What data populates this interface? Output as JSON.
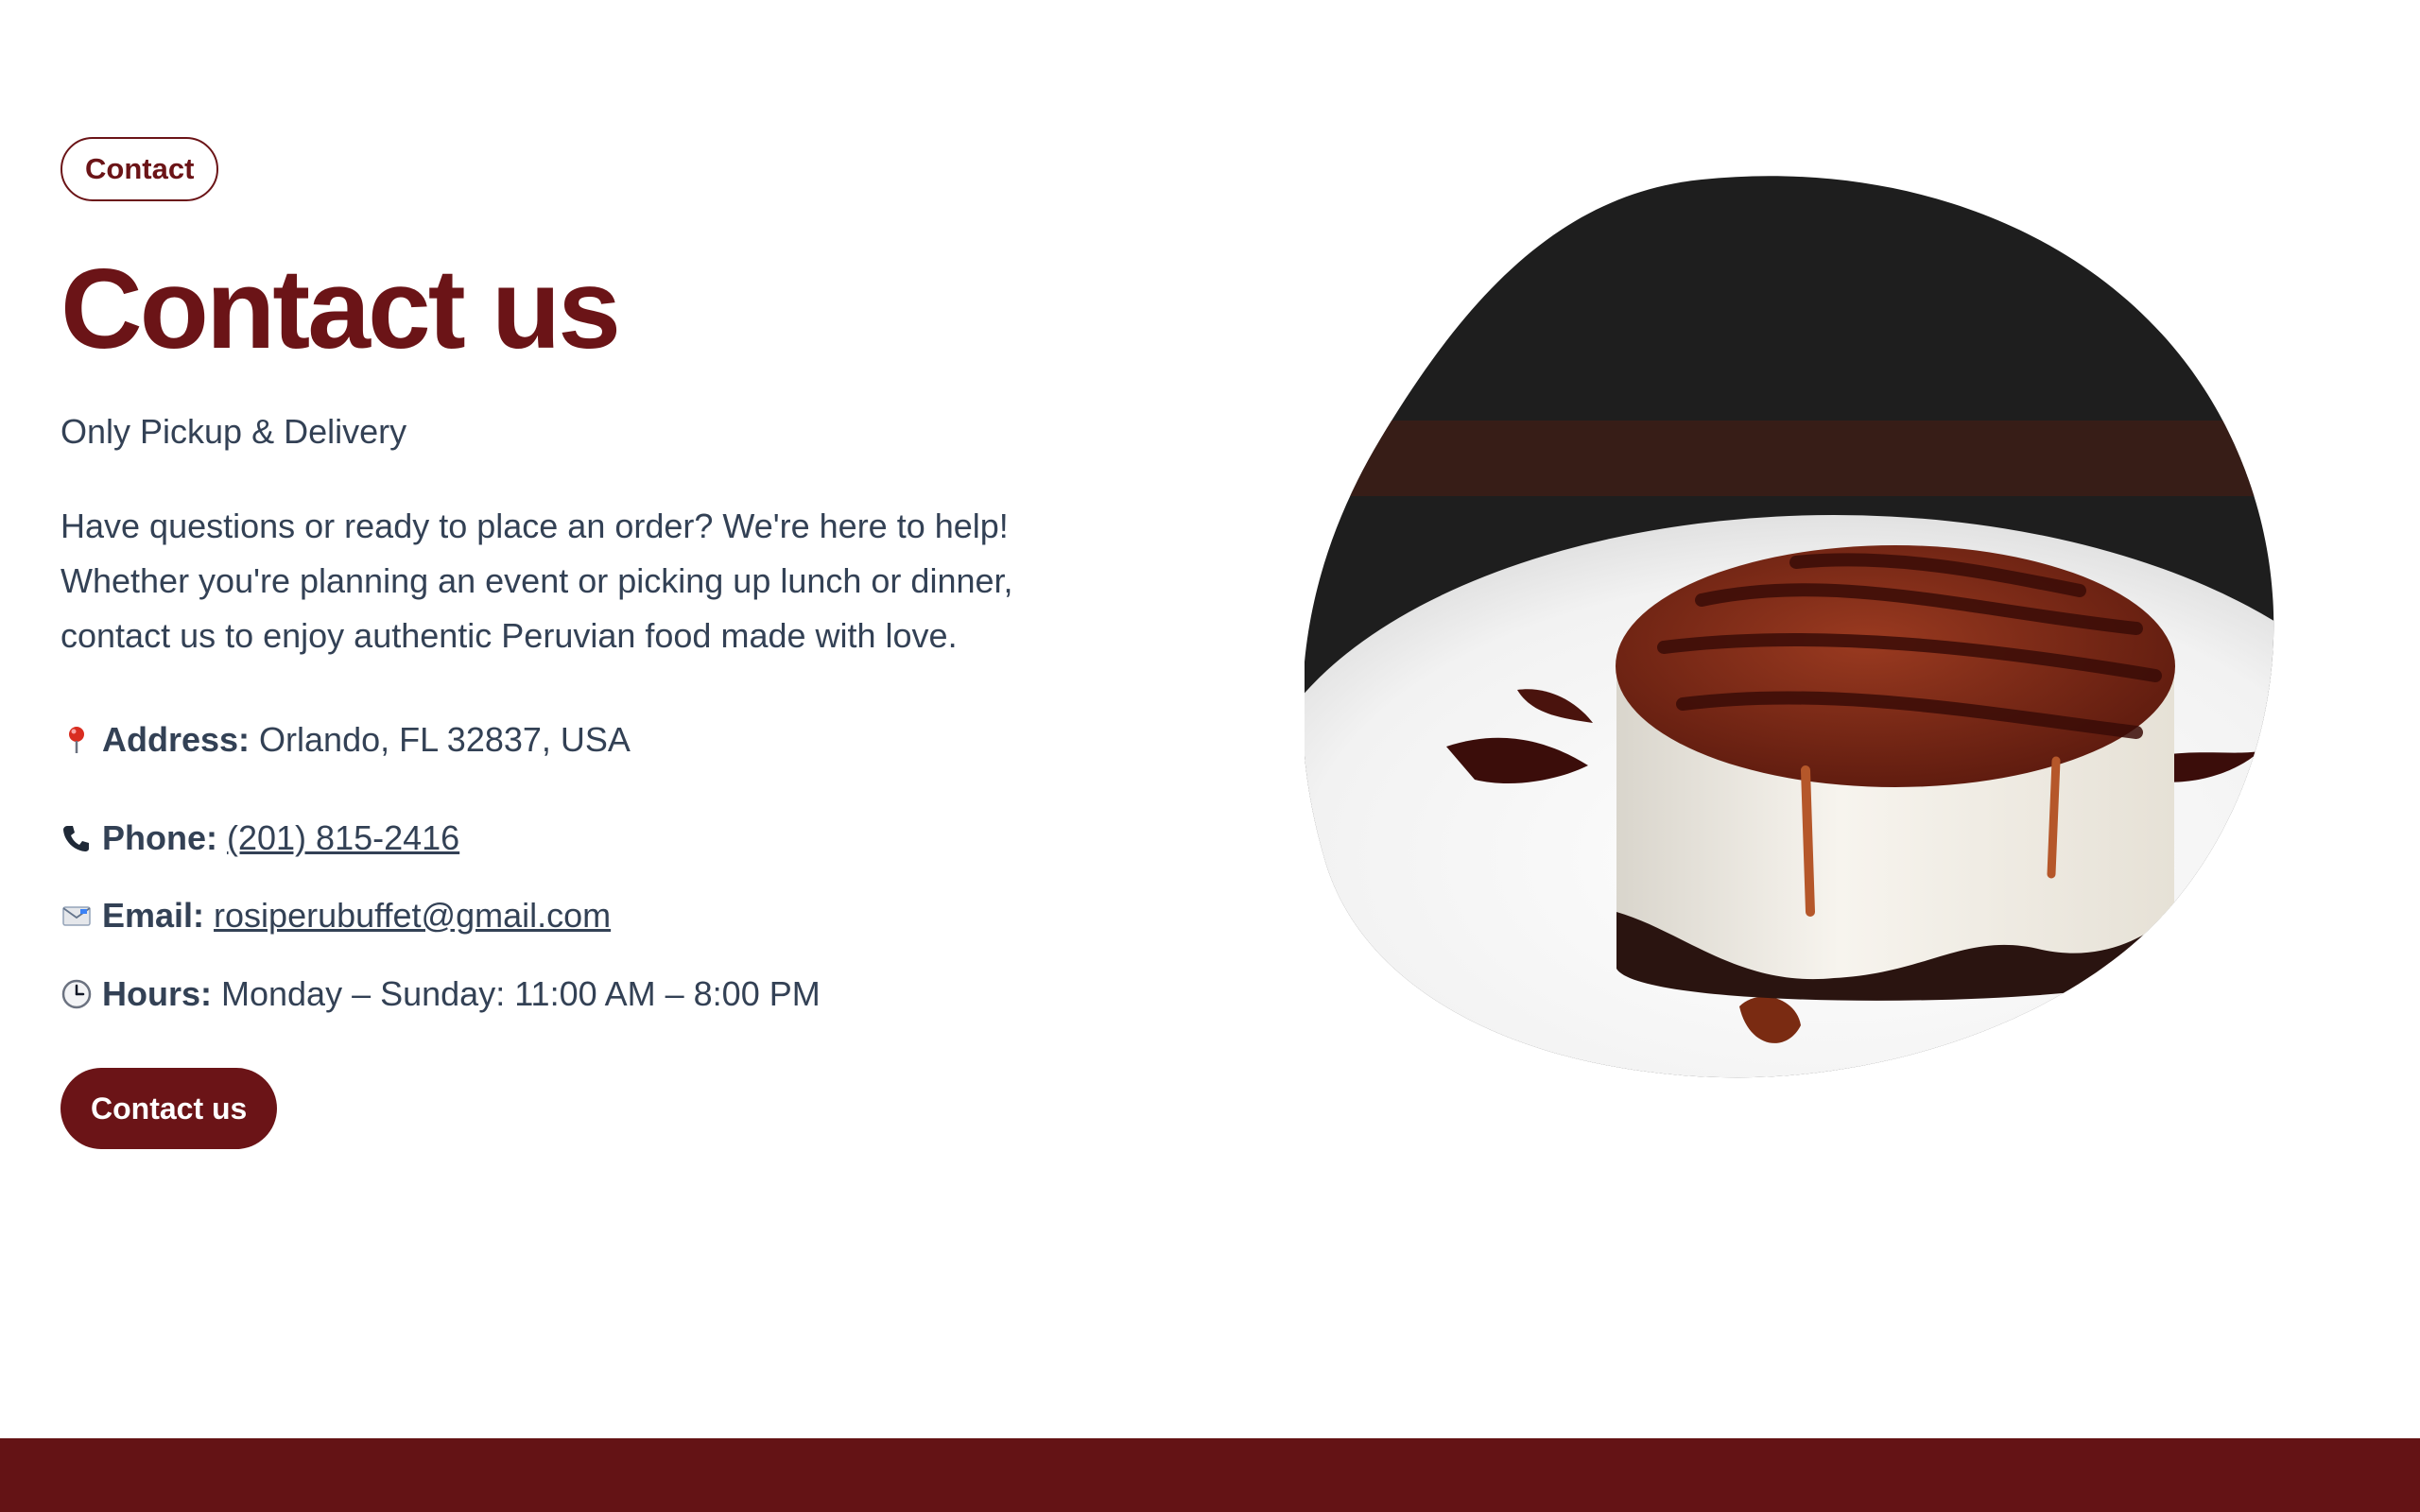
{
  "badge": {
    "label": "Contact"
  },
  "heading": {
    "title": "Contact us",
    "subtitle": "Only Pickup & Delivery"
  },
  "description": {
    "line1": "Have questions or ready to place an order? We're here to help!",
    "line2": "Whether you're planning an event or picking up lunch or dinner,",
    "line3": "contact us to enjoy authentic Peruvian food made with love."
  },
  "contact": {
    "address": {
      "icon": "pin-icon",
      "label": "Address:",
      "value": "Orlando, FL 32837, USA"
    },
    "phone": {
      "icon": "phone-icon",
      "label": "Phone:",
      "value": "(201) 815-2416"
    },
    "email": {
      "icon": "email-icon",
      "label": "Email:",
      "value": "rosiperubuffet@gmail.com"
    },
    "hours": {
      "icon": "clock-icon",
      "label": "Hours:",
      "value": "Monday – Sunday: 11:00 AM – 8:00 PM"
    }
  },
  "cta": {
    "label": "Contact us"
  },
  "image": {
    "subject": "chocolate-topped cheesecake dessert on a white plate"
  },
  "colors": {
    "brand": "#6b1417",
    "text": "#334155",
    "footer": "#641315",
    "background": "#ffffff"
  }
}
